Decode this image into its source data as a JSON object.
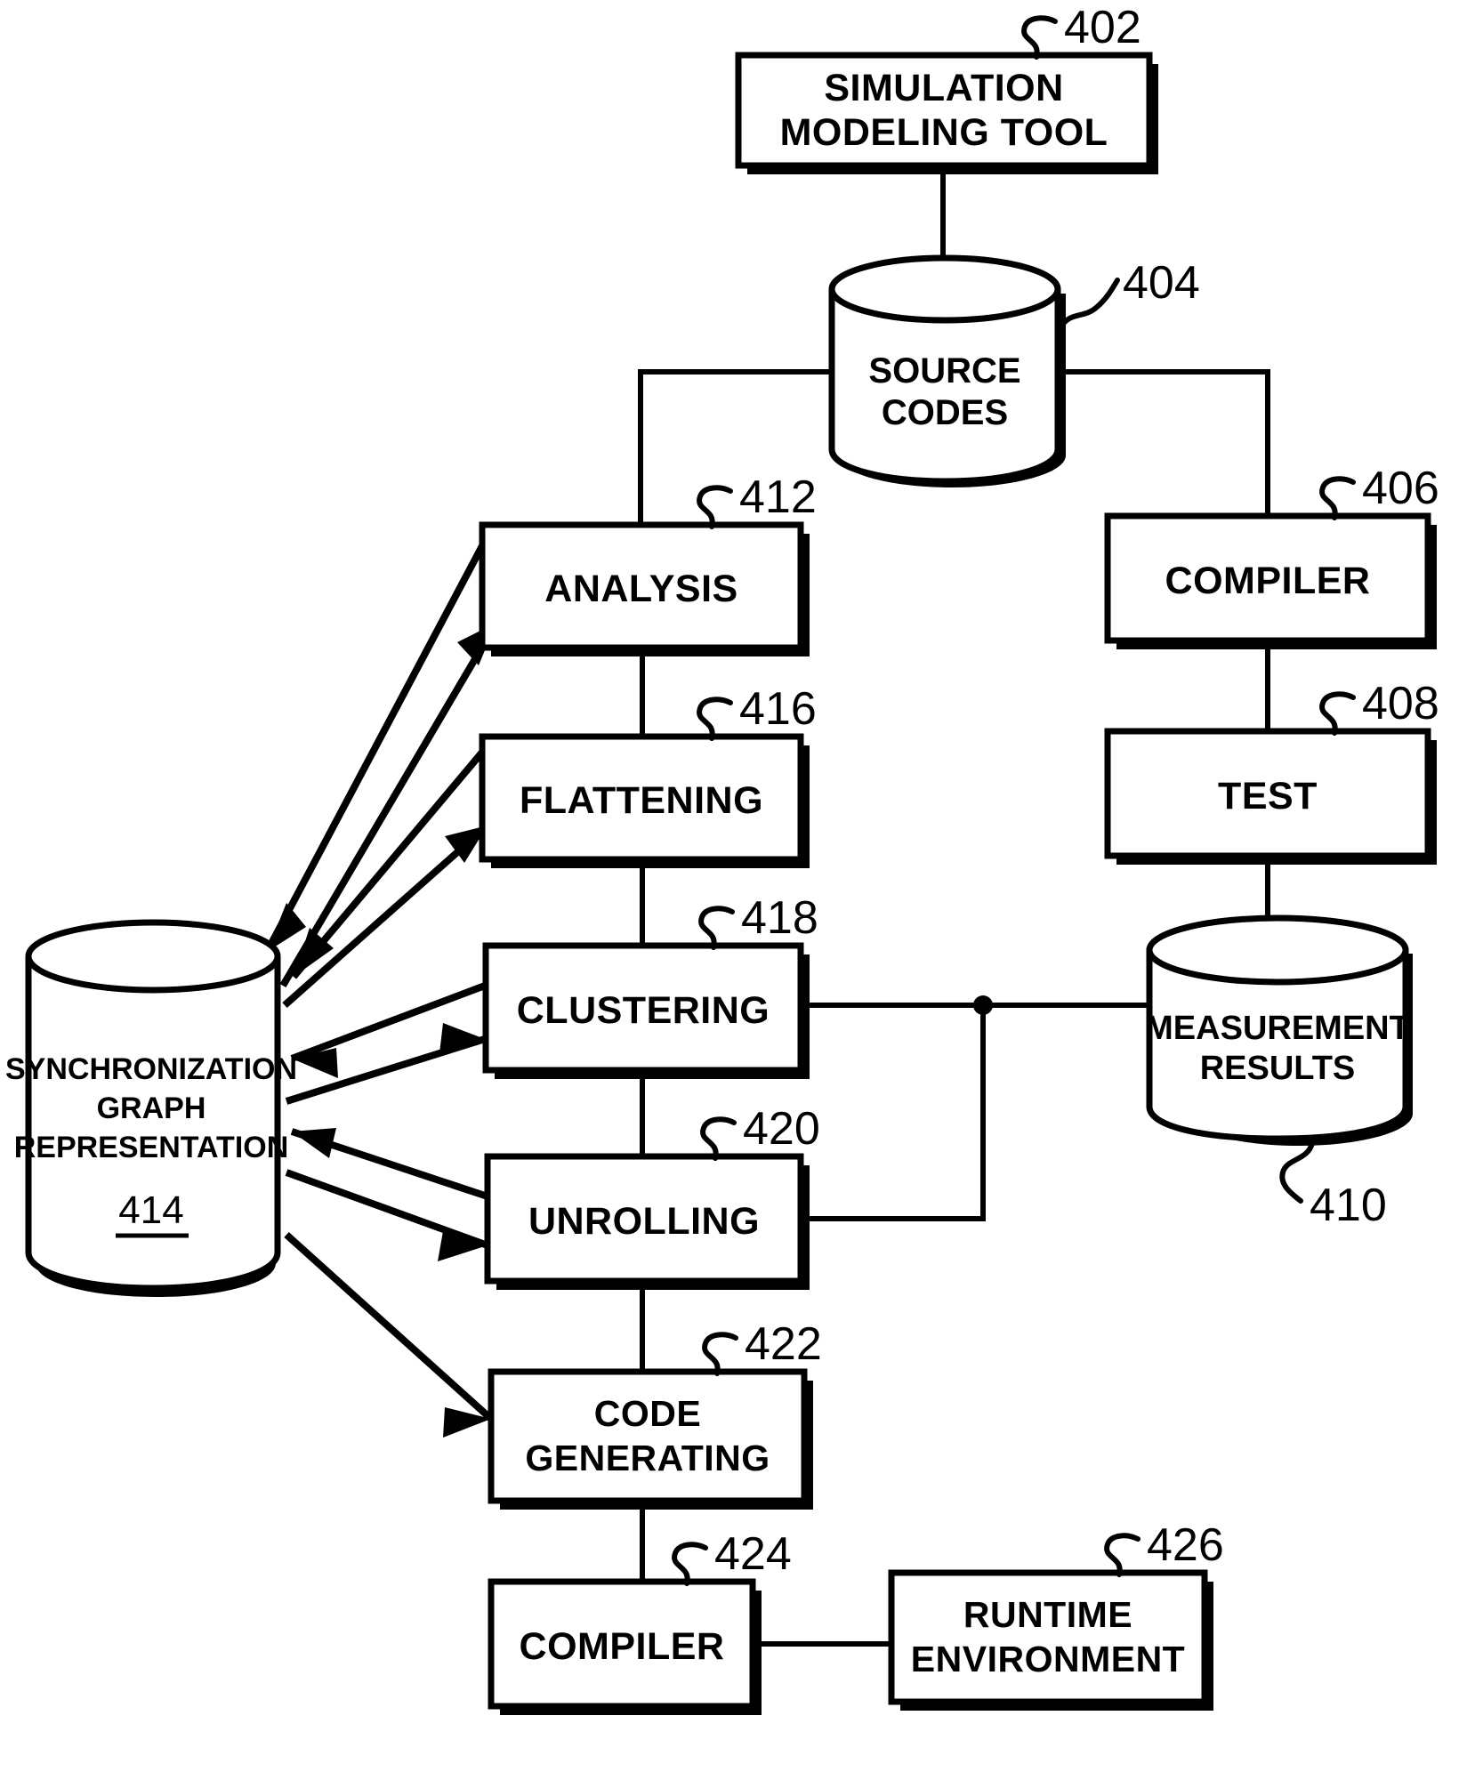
{
  "figure": {
    "type": "patent-flow-diagram",
    "background_color": "#ffffff",
    "ink_color": "#000000"
  },
  "nodes": {
    "simulation_modeling_tool": {
      "label_line1": "SIMULATION",
      "label_line2": "MODELING TOOL",
      "ref": "402",
      "shape": "rectangle"
    },
    "source_codes": {
      "label_line1": "SOURCE",
      "label_line2": "CODES",
      "ref": "404",
      "shape": "cylinder"
    },
    "compiler_right": {
      "label_line1": "COMPILER",
      "ref": "406",
      "shape": "rectangle"
    },
    "test": {
      "label_line1": "TEST",
      "ref": "408",
      "shape": "rectangle"
    },
    "measurement_results": {
      "label_line1": "MEASUREMENT",
      "label_line2": "RESULTS",
      "ref": "410",
      "shape": "cylinder"
    },
    "analysis": {
      "label_line1": "ANALYSIS",
      "ref": "412",
      "shape": "rectangle"
    },
    "sync_graph_representation": {
      "label_line1": "SYNCHRONIZATION",
      "label_line2": "GRAPH",
      "label_line3": "REPRESENTATION",
      "inner_ref": "414",
      "shape": "cylinder"
    },
    "flattening": {
      "label_line1": "FLATTENING",
      "ref": "416",
      "shape": "rectangle"
    },
    "clustering": {
      "label_line1": "CLUSTERING",
      "ref": "418",
      "shape": "rectangle"
    },
    "unrolling": {
      "label_line1": "UNROLLING",
      "ref": "420",
      "shape": "rectangle"
    },
    "code_generating": {
      "label_line1": "CODE",
      "label_line2": "GENERATING",
      "ref": "422",
      "shape": "rectangle"
    },
    "compiler_bottom": {
      "label_line1": "COMPILER",
      "ref": "424",
      "shape": "rectangle"
    },
    "runtime_environment": {
      "label_line1": "RUNTIME",
      "label_line2": "ENVIRONMENT",
      "ref": "426",
      "shape": "rectangle"
    }
  },
  "edges": [
    {
      "from": "simulation_modeling_tool",
      "to": "source_codes",
      "style": "plain-line"
    },
    {
      "from": "source_codes",
      "to": "analysis",
      "style": "plain-line"
    },
    {
      "from": "source_codes",
      "to": "compiler_right",
      "style": "plain-line"
    },
    {
      "from": "compiler_right",
      "to": "test",
      "style": "plain-line"
    },
    {
      "from": "test",
      "to": "measurement_results",
      "style": "plain-line"
    },
    {
      "from": "measurement_results",
      "to": "clustering",
      "style": "plain-line-junction"
    },
    {
      "from": "measurement_results",
      "to": "unrolling",
      "style": "plain-line-junction"
    },
    {
      "from": "analysis",
      "to": "flattening",
      "style": "plain-line"
    },
    {
      "from": "flattening",
      "to": "clustering",
      "style": "plain-line"
    },
    {
      "from": "clustering",
      "to": "unrolling",
      "style": "plain-line"
    },
    {
      "from": "unrolling",
      "to": "code_generating",
      "style": "plain-line"
    },
    {
      "from": "code_generating",
      "to": "compiler_bottom",
      "style": "plain-line"
    },
    {
      "from": "compiler_bottom",
      "to": "runtime_environment",
      "style": "plain-line"
    },
    {
      "from": "analysis",
      "to": "sync_graph_representation",
      "style": "bidirectional-arrow"
    },
    {
      "from": "flattening",
      "to": "sync_graph_representation",
      "style": "bidirectional-arrow"
    },
    {
      "from": "clustering",
      "to": "sync_graph_representation",
      "style": "bidirectional-arrow"
    },
    {
      "from": "unrolling",
      "to": "sync_graph_representation",
      "style": "bidirectional-arrow"
    },
    {
      "from": "sync_graph_representation",
      "to": "code_generating",
      "style": "single-arrow"
    }
  ]
}
